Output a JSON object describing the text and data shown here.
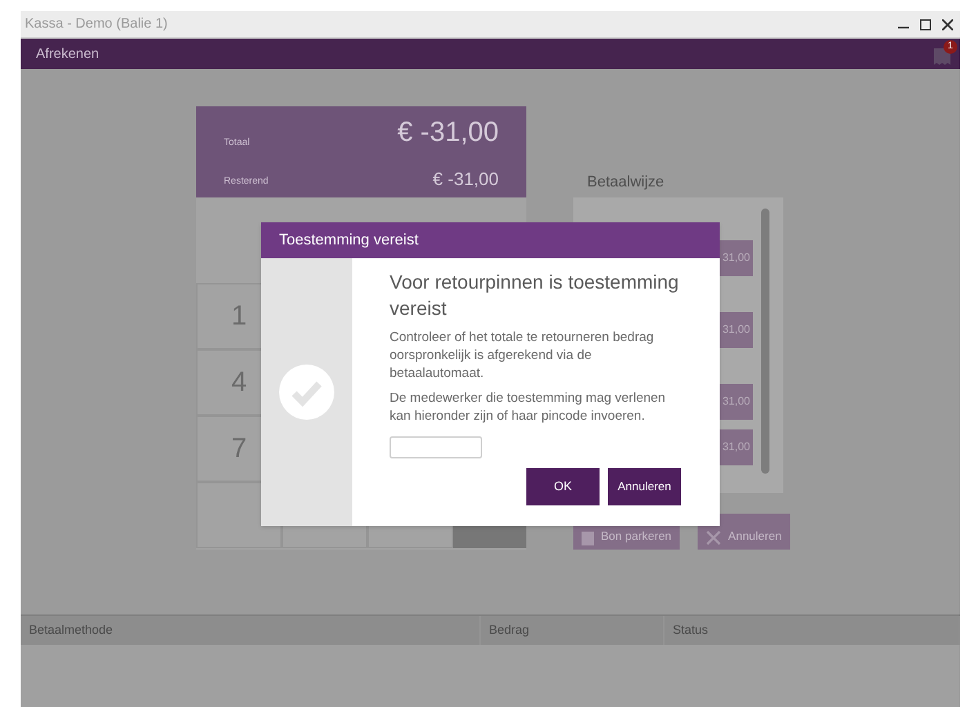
{
  "window": {
    "title": "Kassa - Demo (Balie 1)"
  },
  "header": {
    "title": "Afrekenen",
    "notification_count": "1"
  },
  "summary": [
    {
      "label": "Totaal",
      "amount": "€ -31,00",
      "kind": "large"
    },
    {
      "label": "Resterend",
      "amount": "€ -31,00",
      "kind": "small"
    }
  ],
  "keypad": {
    "keys": [
      "1",
      "4",
      "7"
    ]
  },
  "payment": {
    "title": "Betaalwijze",
    "options": [
      "31,00",
      "31,00",
      "31,00",
      "31,00"
    ],
    "actions": [
      {
        "label": "Bon parkeren",
        "kind": "park"
      },
      {
        "label": "Annuleren",
        "kind": "cancel"
      }
    ]
  },
  "table": {
    "columns": [
      "Betaalmethode",
      "Bedrag",
      "Status"
    ]
  },
  "dialog": {
    "title": "Toestemming vereist",
    "heading": "Voor retourpinnen is toestemming vereist",
    "paragraphs": [
      "Controleer of het totale te retourneren bedrag oorspronkelijk is afgerekend via de betaalautomaat.",
      "De medewerker die toestemming mag verlenen kan hieronder zijn of haar pincode invoeren."
    ],
    "buttons": [
      {
        "label": "OK"
      },
      {
        "label": "Annuleren"
      }
    ]
  }
}
